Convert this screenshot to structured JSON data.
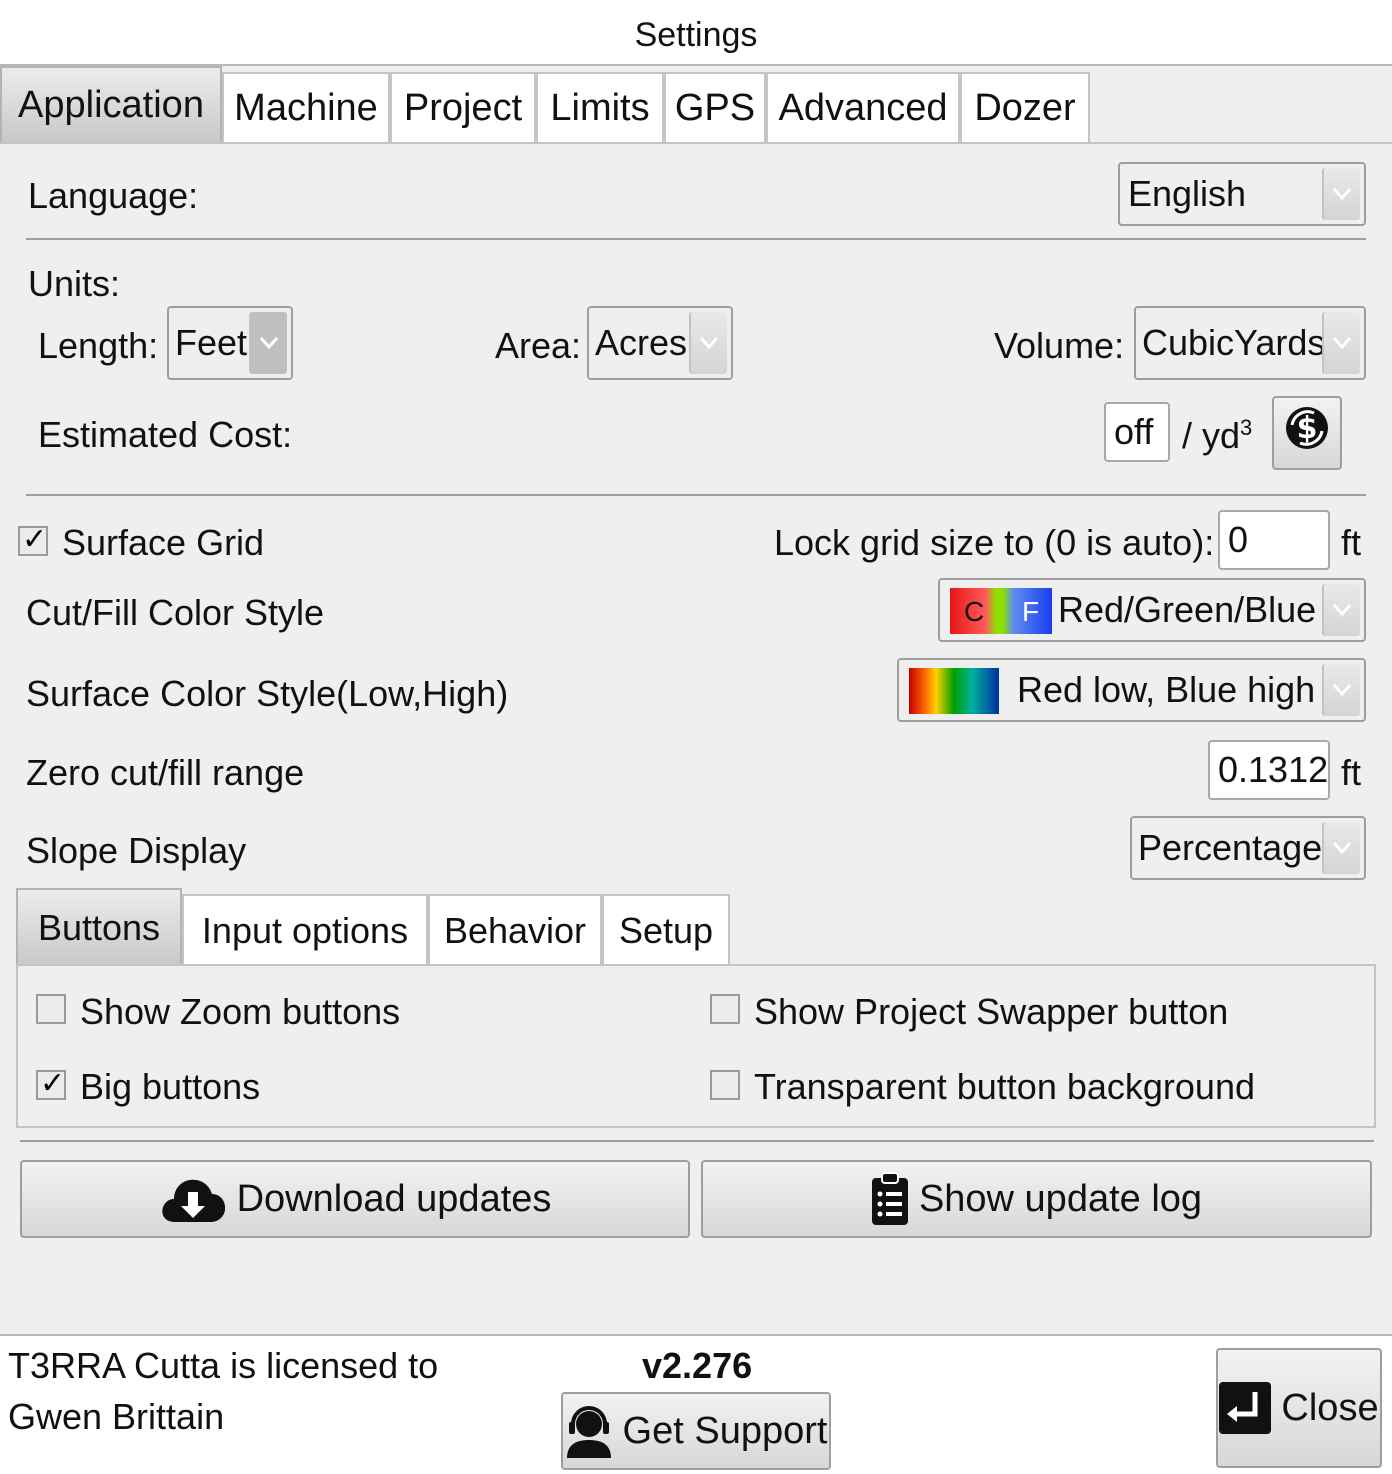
{
  "window": {
    "title": "Settings"
  },
  "tabs": [
    "Application",
    "Machine",
    "Project",
    "Limits",
    "GPS",
    "Advanced",
    "Dozer"
  ],
  "language": {
    "label": "Language:",
    "value": "English"
  },
  "units": {
    "heading": "Units:",
    "length_label": "Length:",
    "length_value": "Feet",
    "area_label": "Area:",
    "area_value": "Acres",
    "volume_label": "Volume:",
    "volume_value": "CubicYards",
    "cost_label": "Estimated Cost:",
    "cost_value": "off",
    "cost_unit": "/ yd",
    "cost_unit_sup": "3"
  },
  "grid": {
    "surface_grid_label": "Surface Grid",
    "surface_grid_checked": true,
    "lock_label": "Lock grid size to (0 is auto):",
    "lock_value": "0",
    "lock_unit": "ft"
  },
  "cut_fill": {
    "label": "Cut/Fill Color Style",
    "value": "Red/Green/Blue",
    "swatch_c": "C",
    "swatch_f": "F"
  },
  "surface_color": {
    "label": "Surface Color Style(Low,High)",
    "value": "Red low, Blue high"
  },
  "zero_range": {
    "label": "Zero cut/fill range",
    "value": "0.1312",
    "unit": "ft"
  },
  "slope": {
    "label": "Slope Display",
    "value": "Percentage"
  },
  "subtabs": [
    "Buttons",
    "Input options",
    "Behavior",
    "Setup"
  ],
  "options": {
    "zoom": {
      "label": "Show Zoom buttons",
      "checked": false
    },
    "swapper": {
      "label": "Show Project Swapper button",
      "checked": false
    },
    "big": {
      "label": "Big buttons",
      "checked": true
    },
    "transparent": {
      "label": "Transparent button background",
      "checked": false
    }
  },
  "actions": {
    "download": "Download updates",
    "log": "Show update log"
  },
  "footer": {
    "license_line1": "T3RRA Cutta is licensed to",
    "license_line2": "Gwen Brittain",
    "version": "v2.276",
    "support": "Get Support",
    "close": "Close"
  },
  "colors": {
    "accent_dark": "#222222",
    "tab_active": "#c8c8c8",
    "background": "#efefef"
  },
  "icons": [
    "currency-icon",
    "cloud-download-icon",
    "clipboard-list-icon",
    "support-agent-icon",
    "enter-icon",
    "chevron-down-icon"
  ]
}
